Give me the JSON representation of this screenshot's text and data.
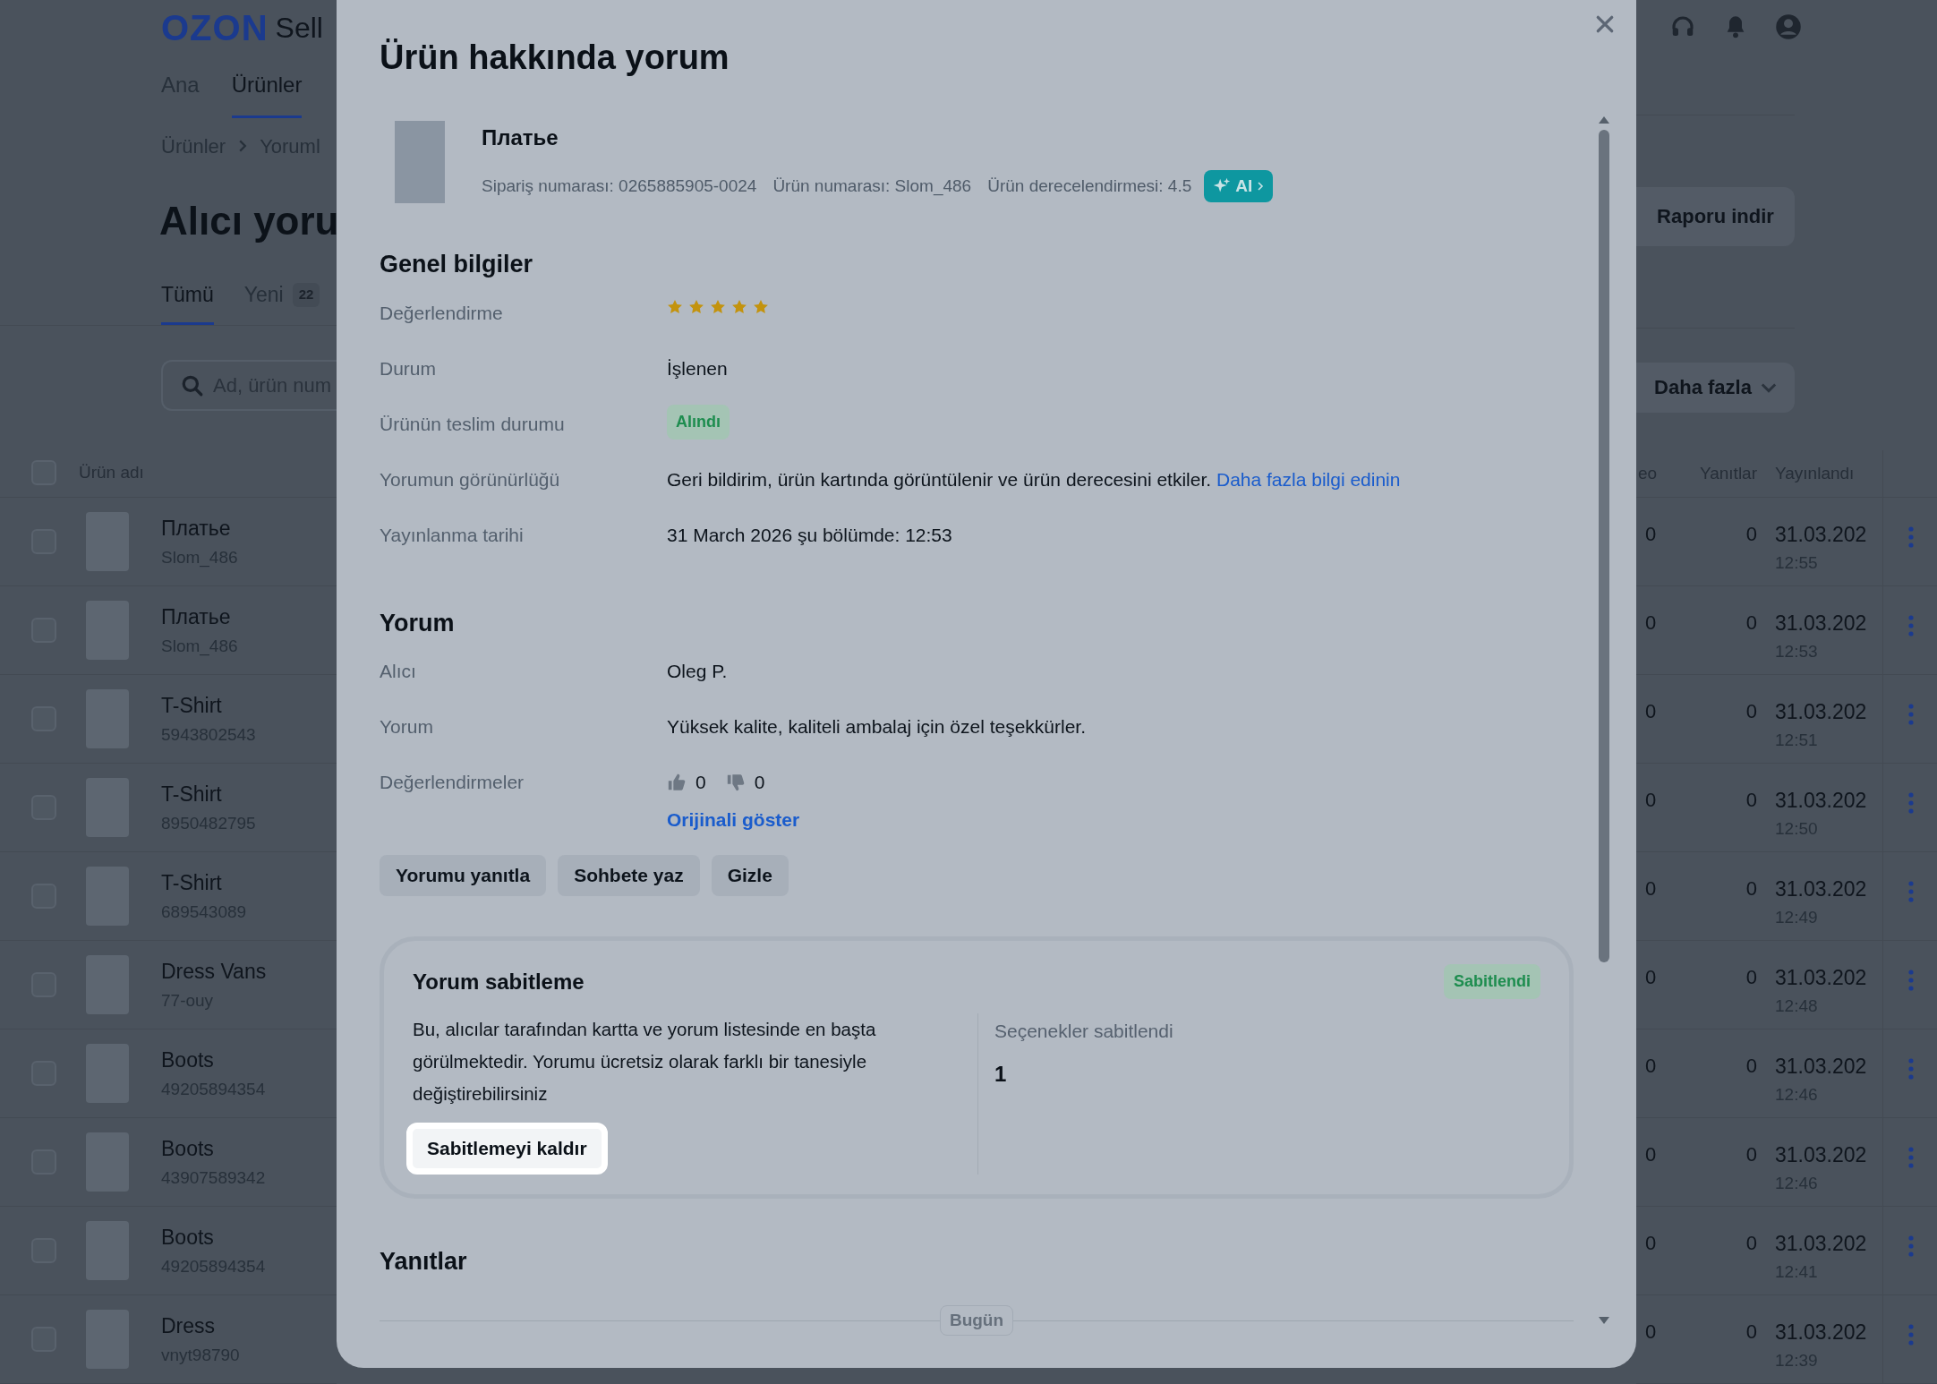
{
  "app": {
    "logo": "OZON",
    "logo_suffix": "Sell",
    "nav": [
      {
        "label": "Ana",
        "selected": false
      },
      {
        "label": "Ürünler",
        "selected": true
      }
    ],
    "breadcrumbs": [
      "Ürünler",
      "Yoruml"
    ],
    "page_title": "Alıcı yoru",
    "tabs": [
      {
        "label": "Tümü",
        "selected": true
      },
      {
        "label": "Yeni",
        "count": "22",
        "selected": false
      }
    ],
    "search": {
      "placeholder": "Ad, ürün num"
    },
    "report_button": "Raporu indir",
    "more_filters": "Daha fazla",
    "table": {
      "header_checked": false,
      "columns": [
        "Ürün adı",
        "eo",
        "Yanıtlar",
        "Yayınlandı"
      ],
      "rows": [
        {
          "checked": false,
          "name": "Платье",
          "sku": "Slom_486",
          "column_2": "0",
          "replies": "0",
          "date": "31.03.202",
          "time": "12:55"
        },
        {
          "checked": false,
          "name": "Платье",
          "sku": "Slom_486",
          "column_2": "0",
          "replies": "0",
          "date": "31.03.202",
          "time": "12:53"
        },
        {
          "checked": false,
          "name": "T-Shirt",
          "sku": "5943802543",
          "column_2": "0",
          "replies": "0",
          "date": "31.03.202",
          "time": "12:51"
        },
        {
          "checked": false,
          "name": "T-Shirt",
          "sku": "8950482795",
          "column_2": "0",
          "replies": "0",
          "date": "31.03.202",
          "time": "12:50"
        },
        {
          "checked": false,
          "name": "T-Shirt",
          "sku": "689543089",
          "column_2": "0",
          "replies": "0",
          "date": "31.03.202",
          "time": "12:49"
        },
        {
          "checked": false,
          "name": "Dress Vans",
          "sku": "77-ouy",
          "column_2": "0",
          "replies": "0",
          "date": "31.03.202",
          "time": "12:48"
        },
        {
          "checked": false,
          "name": "Boots",
          "sku": "49205894354",
          "column_2": "0",
          "replies": "0",
          "date": "31.03.202",
          "time": "12:46"
        },
        {
          "checked": false,
          "name": "Boots",
          "sku": "43907589342",
          "column_2": "0",
          "replies": "0",
          "date": "31.03.202",
          "time": "12:46"
        },
        {
          "checked": false,
          "name": "Boots",
          "sku": "49205894354",
          "column_2": "0",
          "replies": "0",
          "date": "31.03.202",
          "time": "12:41"
        },
        {
          "checked": false,
          "name": "Dress",
          "sku": "vnyt98790",
          "column_2": "0",
          "replies": "0",
          "date": "31.03.202",
          "time": "12:39"
        }
      ]
    }
  },
  "modal": {
    "title": "Ürün hakkında yorum",
    "product": {
      "name": "Платье",
      "meta": [
        "Sipariş numarası: 0265885905-0024",
        "Ürün numarası: Slom_486",
        "Ürün derecelendirmesi: 4.5"
      ],
      "ai_badge": "AI"
    },
    "general": {
      "heading": "Genel bilgiler",
      "fields": [
        {
          "kind": "stars",
          "label": "Değerlendirme",
          "stars": 5
        },
        {
          "kind": "text",
          "label": "Durum",
          "value": "İşlenen"
        },
        {
          "kind": "badge",
          "label": "Ürünün teslim durumu",
          "value": "Alındı"
        },
        {
          "kind": "text_link",
          "label": "Yorumun görünürlüğü",
          "value": "Geri bildirim, ürün kartında görüntülenir ve ürün derecesini etkiler.",
          "link": "Daha fazla bilgi edinin"
        },
        {
          "kind": "text",
          "label": "Yayınlanma tarihi",
          "value": "31 March 2026 şu bölümde: 12:53"
        }
      ]
    },
    "review": {
      "heading": "Yorum",
      "fields": [
        {
          "kind": "text",
          "label": "Alıcı",
          "value": "Oleg P."
        },
        {
          "kind": "text",
          "label": "Yorum",
          "value": "Yüksek kalite, kaliteli ambalaj için özel teşekkürler."
        },
        {
          "kind": "votes",
          "label": "Değerlendirmeler",
          "likes": "0",
          "dislikes": "0",
          "link": "Orijinali göster"
        }
      ],
      "actions": [
        "Yorumu yanıtla",
        "Sohbete yaz",
        "Gizle"
      ]
    },
    "pin": {
      "title": "Yorum sabitleme",
      "status": "Sabitlendi",
      "description": "Bu, alıcılar tarafından kartta ve yorum listesinde en başta görülmektedir. Yorumu ücretsiz olarak farklı bir tanesiyle değiştirebilirsiniz",
      "button": "Sabitlemeyi kaldır",
      "stat_label": "Seçenekler sabitlendi",
      "stat_value": "1"
    },
    "replies": {
      "heading": "Yanıtlar",
      "date_chip": "Bugün"
    }
  }
}
